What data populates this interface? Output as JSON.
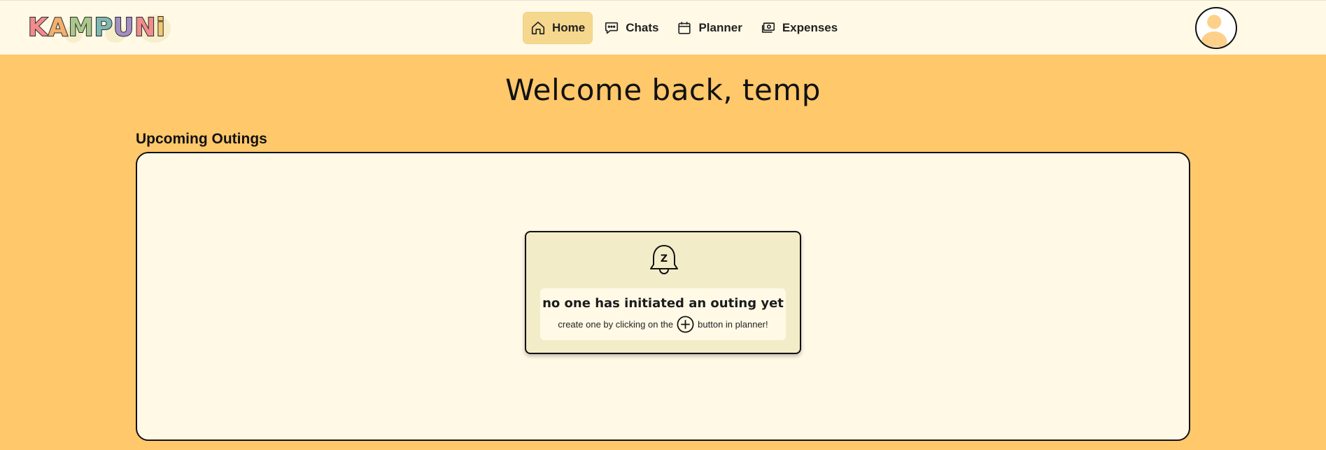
{
  "logo": {
    "letters": [
      "K",
      "A",
      "M",
      "P",
      "U",
      "N",
      "i"
    ],
    "colors": [
      "#F08C8C",
      "#F3B06E",
      "#A9C98A",
      "#7FB7B2",
      "#A48FC2",
      "#F08C8C",
      "#F3C96B"
    ]
  },
  "nav": {
    "items": [
      {
        "label": "Home",
        "icon": "home-icon",
        "active": true
      },
      {
        "label": "Chats",
        "icon": "chat-icon",
        "active": false
      },
      {
        "label": "Planner",
        "icon": "calendar-icon",
        "active": false
      },
      {
        "label": "Expenses",
        "icon": "money-icon",
        "active": false
      }
    ]
  },
  "page": {
    "title": "Welcome back, temp",
    "section_label": "Upcoming Outings"
  },
  "empty_state": {
    "icon": "bell-z-icon",
    "title": "no one has initiated an outing yet",
    "subtitle_before": "create one by clicking on the",
    "subtitle_icon": "plus-circle-icon",
    "subtitle_after": "button in planner!"
  },
  "colors": {
    "background": "#FFC86B",
    "header": "#FFF9E6",
    "active_tab": "#F5D88E",
    "card": "#F3ECC9"
  }
}
